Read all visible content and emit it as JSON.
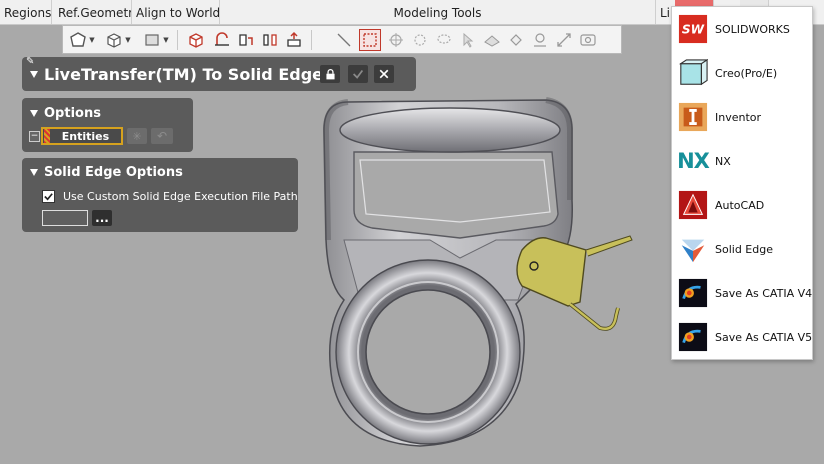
{
  "ribbon": {
    "groups": [
      "Regions",
      "Ref.Geometry",
      "Align to World",
      "Modeling Tools",
      "Li"
    ]
  },
  "transfer_panel": {
    "title": "LiveTransfer(TM) To Solid Edge"
  },
  "options_panel": {
    "title": "Options",
    "entities_label": "Entities"
  },
  "se_options_panel": {
    "title": "Solid Edge Options",
    "checkbox_label": "Use Custom Solid Edge Execution File Path",
    "checkbox_checked": true,
    "path_value": "",
    "browse_label": "..."
  },
  "menu": {
    "items": [
      {
        "label": "SOLIDWORKS",
        "icon": "solidworks-icon"
      },
      {
        "label": "Creo(Pro/E)",
        "icon": "creo-icon"
      },
      {
        "label": "Inventor",
        "icon": "inventor-icon"
      },
      {
        "label": "NX",
        "icon": "nx-icon"
      },
      {
        "label": "AutoCAD",
        "icon": "autocad-icon"
      },
      {
        "label": "Solid Edge",
        "icon": "solid-edge-icon"
      },
      {
        "label": "Save As CATIA V4",
        "icon": "catia-v4-icon"
      },
      {
        "label": "Save As CATIA V5",
        "icon": "catia-v5-icon"
      }
    ]
  },
  "colors": {
    "viewport": "#a9a9a9",
    "panel": "#5b5b5b",
    "highlight": "#d6a21e",
    "part": "#c7c7c9",
    "bracket": "#c8c05a"
  }
}
